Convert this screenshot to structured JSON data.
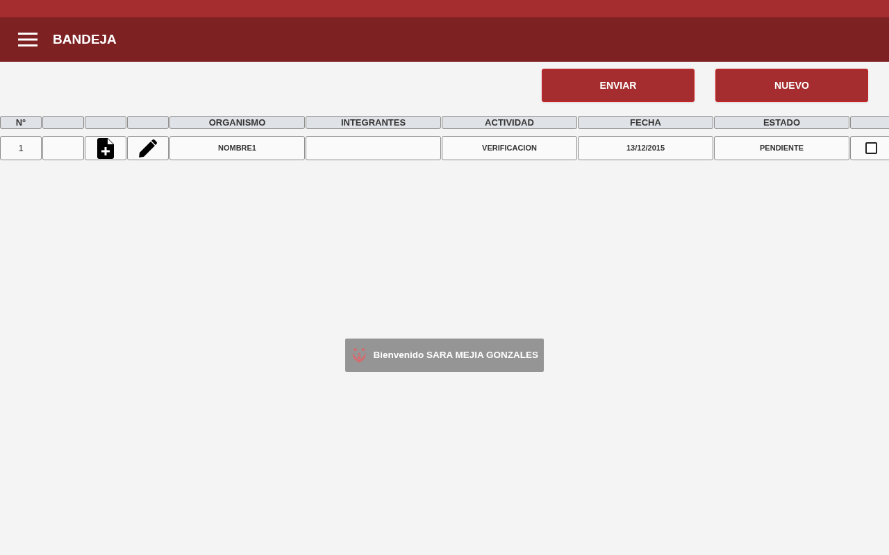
{
  "app_bar": {
    "title": "BANDEJA"
  },
  "buttons": [
    "ENVIAR",
    "NUEVO"
  ],
  "table": {
    "columns": [
      {
        "kind": "label",
        "label": "N°"
      },
      {
        "kind": "blank"
      },
      {
        "kind": "blank"
      },
      {
        "kind": "blank"
      },
      {
        "kind": "label",
        "label": "ORGANISMO"
      },
      {
        "kind": "label",
        "label": "INTEGRANTES"
      },
      {
        "kind": "label",
        "label": "ACTIVIDAD"
      },
      {
        "kind": "label",
        "label": "FECHA"
      },
      {
        "kind": "label",
        "label": "ESTADO"
      },
      {
        "kind": "blank"
      }
    ],
    "rows": [
      {
        "cells": [
          {
            "kind": "text",
            "text": "1"
          },
          {
            "kind": "blank"
          },
          {
            "kind": "add-doc"
          },
          {
            "kind": "edit"
          },
          {
            "kind": "text",
            "text": "NOMBRE1"
          },
          {
            "kind": "blank"
          },
          {
            "kind": "text",
            "text": "VERIFICACION"
          },
          {
            "kind": "text",
            "text": "13/12/2015"
          },
          {
            "kind": "text",
            "text": "PENDIENTE"
          },
          {
            "kind": "checkbox",
            "checked": false
          }
        ]
      }
    ]
  },
  "toast": {
    "text": "Bienvenido SARA MEJIA GONZALES"
  }
}
